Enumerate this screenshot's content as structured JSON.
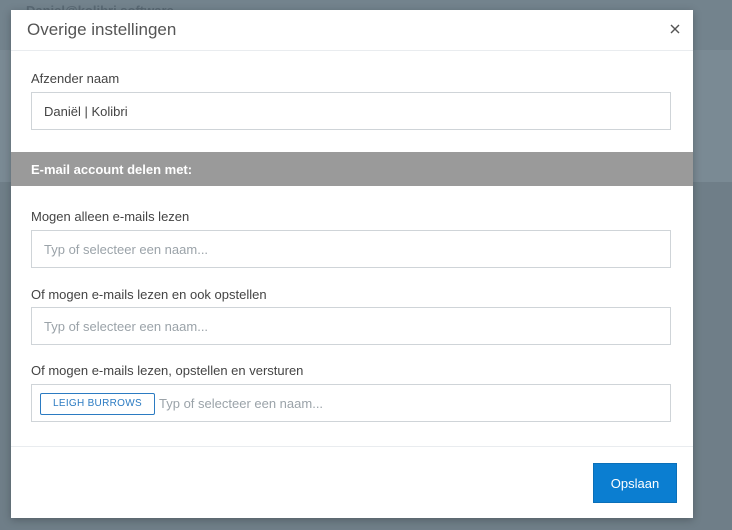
{
  "background": {
    "account_email": "Daniel@kolibri.software"
  },
  "dialog": {
    "title": "Overige instellingen",
    "close_glyph": "×",
    "sender": {
      "label": "Afzender naam",
      "value": "Daniël | Kolibri"
    },
    "share_section": {
      "title": "E-mail account delen met:"
    },
    "fields": [
      {
        "label": "Mogen alleen e-mails lezen",
        "placeholder": "Typ of selecteer een naam...",
        "tags": []
      },
      {
        "label": "Of mogen e-mails lezen en ook opstellen",
        "placeholder": "Typ of selecteer een naam...",
        "tags": []
      },
      {
        "label": "Of mogen e-mails lezen, opstellen en versturen",
        "placeholder": "Typ of selecteer een naam...",
        "tags": [
          "LEIGH BURROWS"
        ]
      }
    ],
    "save_label": "Opslaan"
  },
  "colors": {
    "primary": "#0b7ed1",
    "section_bar": "#9a9a9a",
    "overlay": "#6f7e88"
  },
  "icons": {
    "close": "close-icon"
  }
}
